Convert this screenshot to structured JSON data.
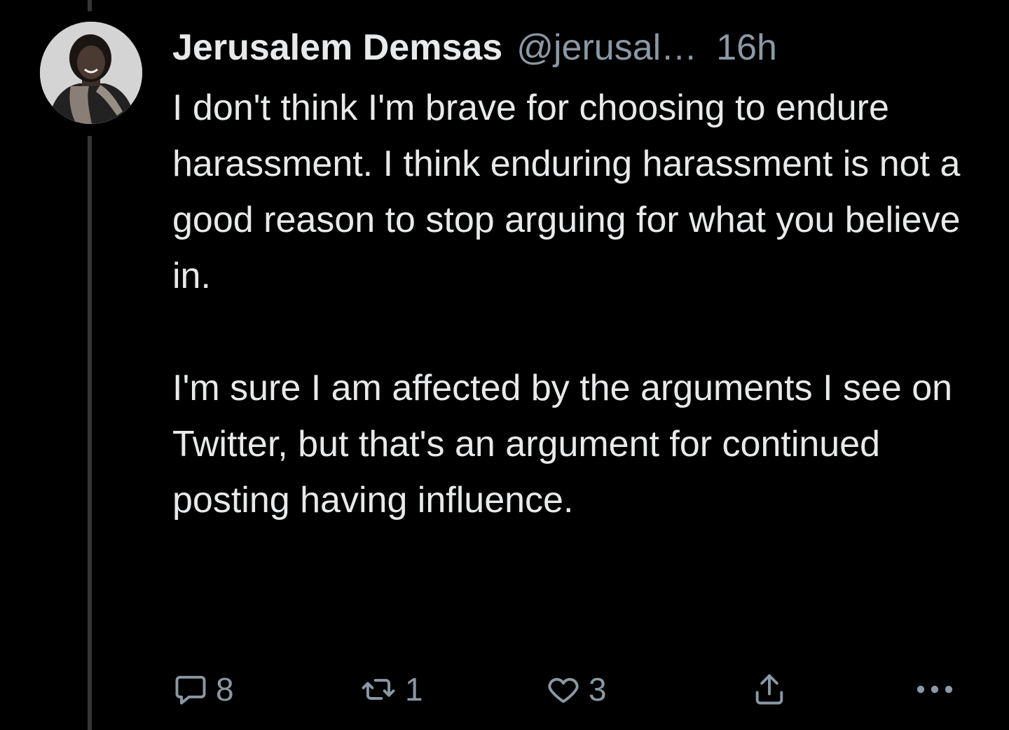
{
  "tweet": {
    "author_name": "Jerusalem Demsas",
    "handle": "@jerusalem...",
    "separator": "·",
    "time": "16h",
    "paragraphs": [
      "I don't think I'm brave for choosing to endure harassment. I think enduring harassment is not a good reason to stop arguing for what you believe in.",
      "I'm sure I am affected by the arguments I see on Twitter, but that's an argument for continued posting having influence."
    ]
  },
  "actions": {
    "reply_count": "8",
    "retweet_count": "1",
    "like_count": "3"
  },
  "icons": {
    "reply": "speech-bubble-icon",
    "retweet": "retweet-icon",
    "like": "heart-icon",
    "share": "share-icon",
    "more": "more-dots-icon"
  },
  "colors": {
    "background": "#000000",
    "primary_text": "#e7e9ea",
    "secondary_text": "#8b98a5",
    "thread_line": "#333639"
  }
}
